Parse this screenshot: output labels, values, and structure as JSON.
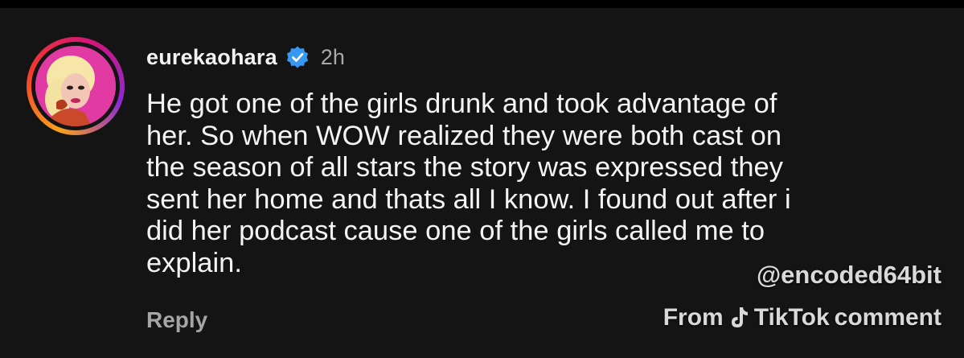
{
  "comment": {
    "username": "eurekaohara",
    "verified_icon": "verified-badge-icon",
    "timestamp": "2h",
    "text": "He got one of the girls drunk and took advantage of\nher. So when WOW realized they were both cast on\nthe season of all stars the story was expressed they\nsent her home and thats all I know. I found out after i\ndid her podcast cause one of the girls called me to\nexplain.",
    "reply_label": "Reply"
  },
  "watermark": {
    "handle": "@encoded64bit",
    "source_from": "From",
    "source_icon": "tiktok-logo-icon",
    "source_brand": "TikTok",
    "source_suffix": "comment"
  },
  "colors": {
    "background": "#141415",
    "verified": "#3897f0",
    "avatar_bg": "#e23aa3"
  }
}
